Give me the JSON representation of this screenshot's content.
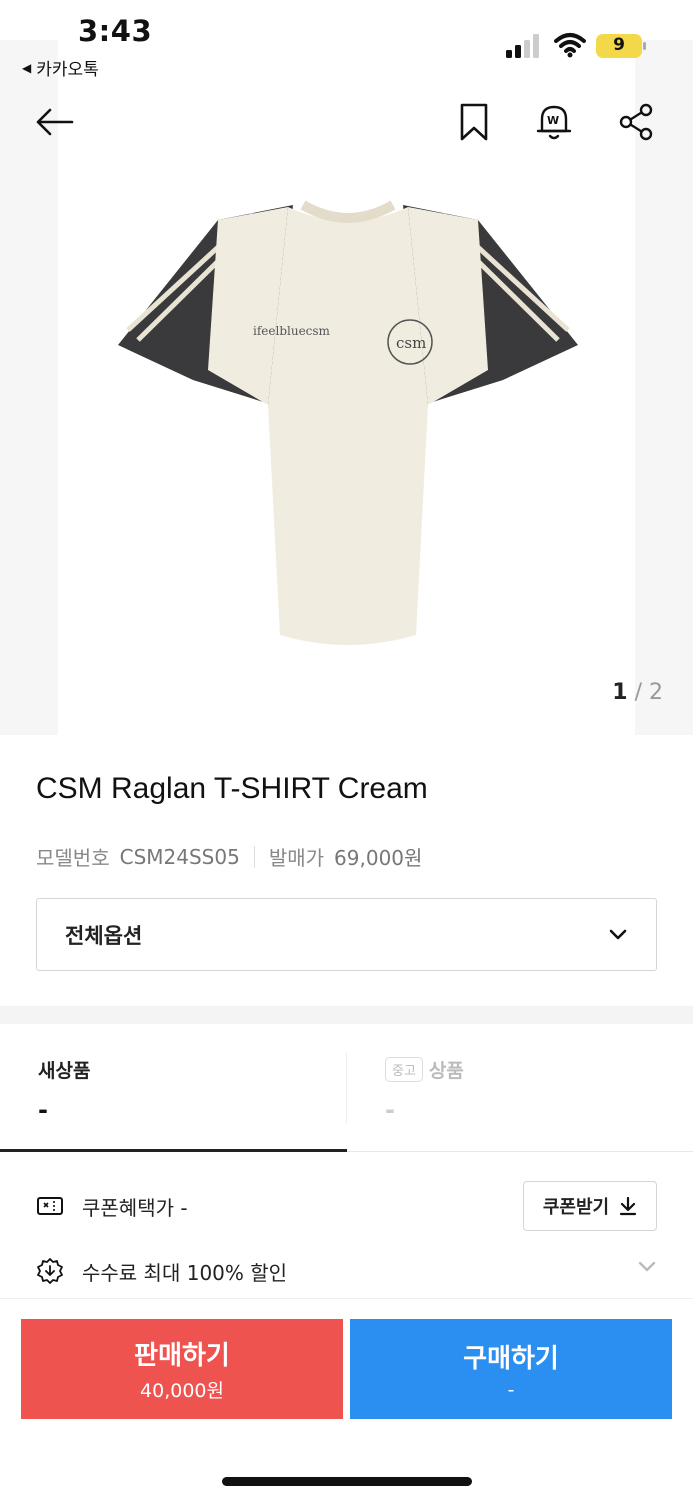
{
  "status_bar": {
    "time": "3:43",
    "back_app": "카카오톡",
    "battery_level": "9"
  },
  "nav": {
    "back_icon": "arrow-left-icon",
    "bookmark_icon": "bookmark-icon",
    "alarm_icon": "price-alert-bell-icon",
    "share_icon": "share-icon"
  },
  "gallery": {
    "current": "1",
    "separator": "/",
    "total": "2",
    "shirt_logo_text": "ifeelbluecsm",
    "shirt_badge_text": "csm"
  },
  "product": {
    "title": "CSM Raglan T-SHIRT Cream",
    "model_label": "모델번호",
    "model_value": "CSM24SS05",
    "release_label": "발매가",
    "release_value": "69,000원"
  },
  "option": {
    "label": "전체옵션"
  },
  "tabs": {
    "new": {
      "title": "새상품",
      "price": "-"
    },
    "used": {
      "badge": "중고",
      "title": "상품",
      "price": "-"
    }
  },
  "coupon": {
    "text": "쿠폰혜택가 -",
    "button": "쿠폰받기"
  },
  "fee": {
    "text": "수수료 최대 100% 할인"
  },
  "actions": {
    "sell_label": "판매하기",
    "sell_price": "40,000원",
    "buy_label": "구매하기",
    "buy_price": "-"
  },
  "colors": {
    "sell": "#ef5350",
    "buy": "#2a8ff0",
    "shirt_body": "#f1ece0",
    "shirt_sleeve": "#3a3a3c"
  }
}
